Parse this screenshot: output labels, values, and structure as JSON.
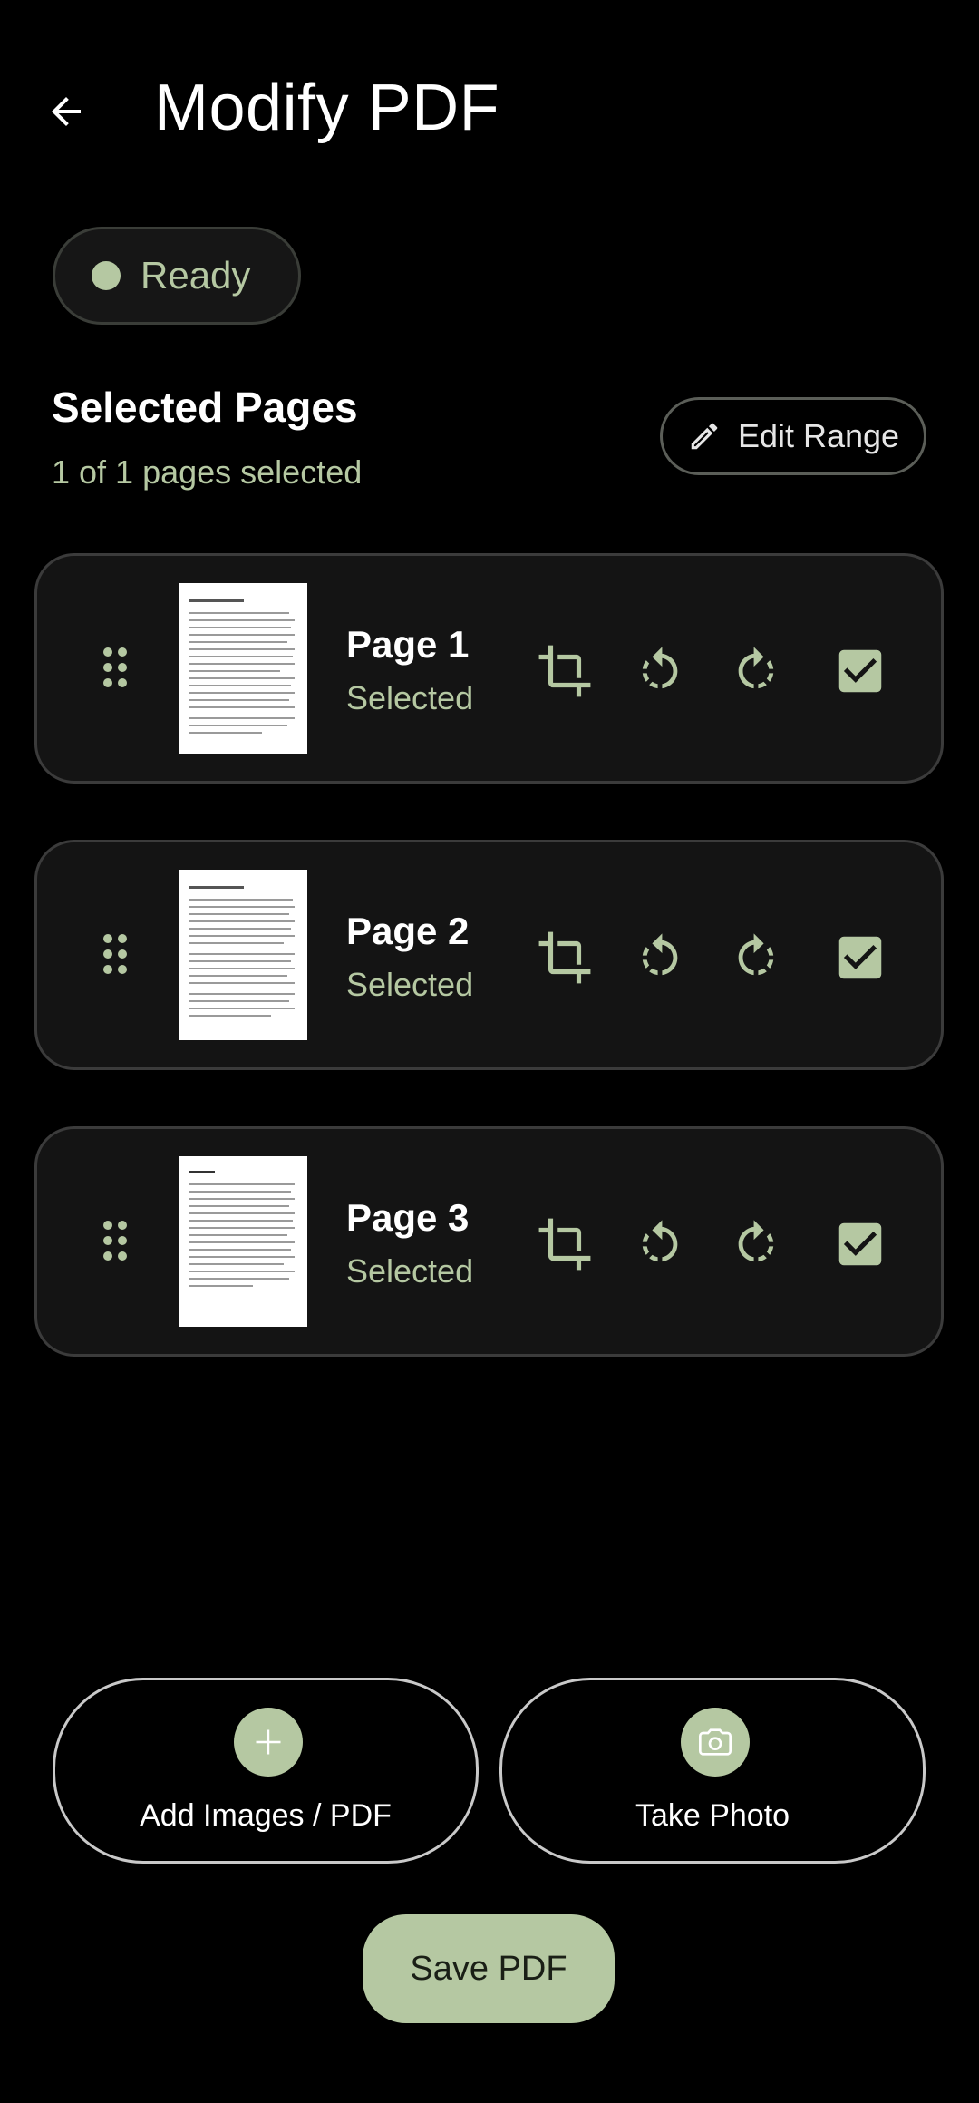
{
  "header": {
    "title": "Modify PDF",
    "back_icon": "arrow-back-icon"
  },
  "status": {
    "label": "Ready",
    "dot_color": "#b5c8a2"
  },
  "selection": {
    "title": "Selected Pages",
    "subtitle": "1 of 1 pages selected",
    "edit_range_label": "Edit Range",
    "edit_icon": "pencil-icon"
  },
  "pages": [
    {
      "name": "Page 1",
      "status": "Selected",
      "checked": true
    },
    {
      "name": "Page 2",
      "status": "Selected",
      "checked": true
    },
    {
      "name": "Page 3",
      "status": "Selected",
      "checked": true
    }
  ],
  "page_icons": {
    "drag": "drag-handle-icon",
    "crop": "crop-icon",
    "rotate_left": "rotate-left-icon",
    "rotate_right": "rotate-right-icon",
    "check": "checkbox-checked-icon"
  },
  "actions": {
    "add_label": "Add Images / PDF",
    "add_icon": "plus-icon",
    "photo_label": "Take Photo",
    "photo_icon": "camera-icon"
  },
  "save": {
    "label": "Save PDF"
  },
  "colors": {
    "accent": "#b5c8a2",
    "background": "#000000",
    "card": "#141414"
  }
}
